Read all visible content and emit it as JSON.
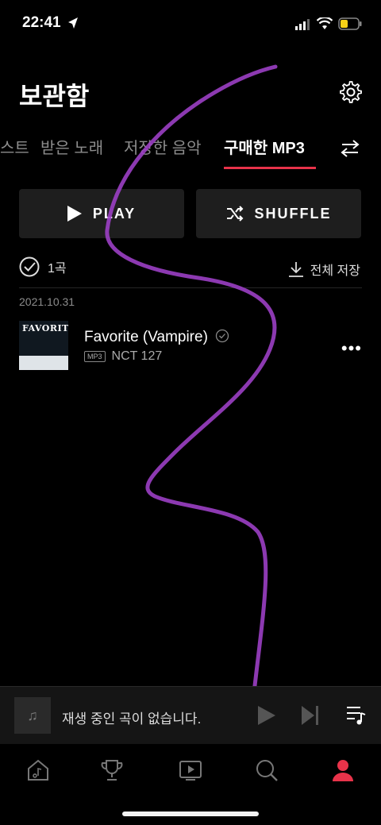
{
  "status": {
    "time": "22:41"
  },
  "header": {
    "title": "보관함"
  },
  "tabs": [
    {
      "label": "스트"
    },
    {
      "label": "받은 노래"
    },
    {
      "label": "저장한 음악"
    },
    {
      "label": "구매한 MP3",
      "active": true
    }
  ],
  "actions": {
    "play_label": "PLAY",
    "shuffle_label": "SHUFFLE"
  },
  "list": {
    "count": "1곡",
    "save_all": "전체 저장",
    "date": "2021.10.31",
    "items": [
      {
        "title": "Favorite (Vampire)",
        "badge": "MP3",
        "artist": "NCT 127",
        "album_text": "FAVORITE"
      }
    ]
  },
  "player": {
    "text": "재생 중인 곡이 없습니다.",
    "note_icon": "♫"
  },
  "colors": {
    "accent": "#e8334a",
    "background": "#000000",
    "stroke": "#9b3fc4"
  }
}
